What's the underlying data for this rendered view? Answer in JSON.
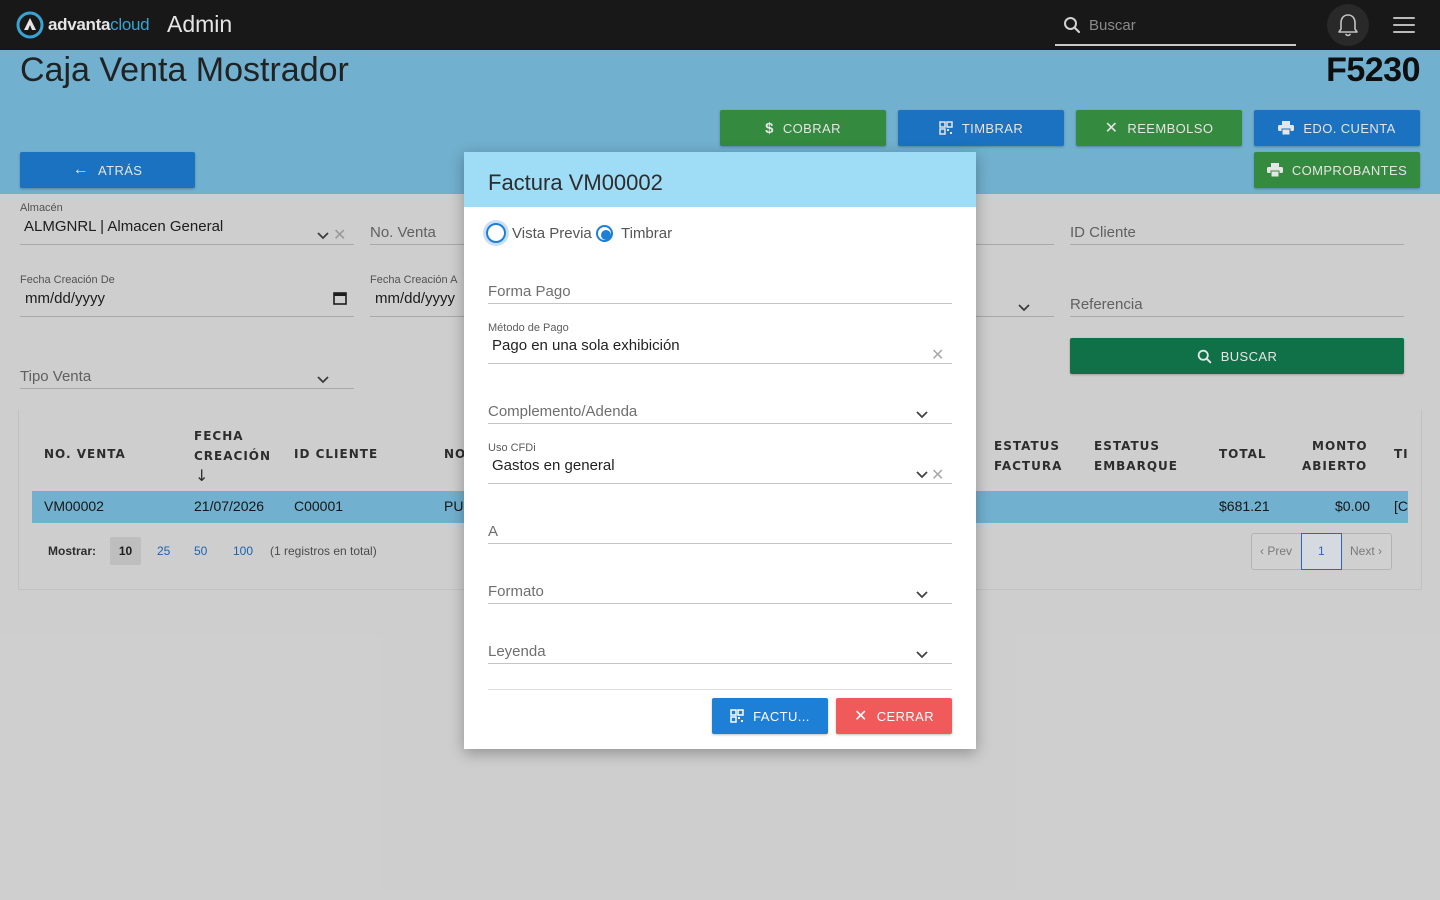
{
  "topbar": {
    "logo_brand": "advanta",
    "logo_cloud": "cloud",
    "title": "Admin",
    "search_placeholder": "Buscar",
    "icons": [
      "search-icon",
      "bell-icon",
      "hamburger-menu-icon"
    ]
  },
  "header": {
    "page_title": "Caja Venta Mostrador",
    "code": "F5230",
    "buttons": {
      "cobrar": "COBRAR",
      "timbrar": "TIMBRAR",
      "reembolso": "REEMBOLSO",
      "edo_cuenta": "EDO. CUENTA",
      "comprobantes": "COMPROBANTES",
      "atras": "ATRÁS"
    }
  },
  "filters": {
    "almacen_label": "Almacén",
    "almacen_value": "ALMGNRL | Almacen General",
    "no_venta": "No. Venta",
    "id_cliente": "ID Cliente",
    "fecha_de_label": "Fecha Creación De",
    "fecha_de_value": "mm/dd/yyyy",
    "fecha_a_label": "Fecha Creación A",
    "fecha_a_value": "mm/dd/yyyy",
    "referencia": "Referencia",
    "tipo_venta": "Tipo Venta",
    "buscar": "BUSCAR"
  },
  "table": {
    "headers": {
      "no_venta": "NO. VENTA",
      "fecha_1": "FECHA",
      "fecha_2": "CREACIÓN",
      "id_cliente": "ID CLIENTE",
      "nombre": "NO",
      "estatus_factura_1": "ESTATUS",
      "estatus_factura_2": "FACTURA",
      "estatus_embarque_1": "ESTATUS",
      "estatus_embarque_2": "EMBARQUE",
      "total": "TOTAL",
      "monto_1": "MONTO",
      "monto_2": "ABIERTO",
      "ti": "TI"
    },
    "rows": [
      {
        "no_venta": "VM00002",
        "fecha": "21/07/2026",
        "id_cliente": "C00001",
        "nombre": "PU",
        "total": "$681.21",
        "monto_abierto": "$0.00",
        "ti": "[C"
      }
    ],
    "mostrar_label": "Mostrar:",
    "page_sizes": [
      "10",
      "25",
      "50",
      "100"
    ],
    "total_text": "(1 registros en total)",
    "prev": "‹ Prev",
    "page": "1",
    "next": "Next ›"
  },
  "modal": {
    "title": "Factura VM00002",
    "radio_preview": "Vista Previa",
    "radio_timbrar": "Timbrar",
    "forma_pago": "Forma Pago",
    "metodo_pago_label": "Método de Pago",
    "metodo_pago_value": "Pago en una sola exhibición",
    "complemento": "Complemento/Adenda",
    "uso_cfdi_label": "Uso CFDi",
    "uso_cfdi_value": "Gastos en general",
    "a": "A",
    "formato": "Formato",
    "leyenda": "Leyenda",
    "facturar_button": "FACTU...",
    "cerrar_button": "CERRAR"
  }
}
